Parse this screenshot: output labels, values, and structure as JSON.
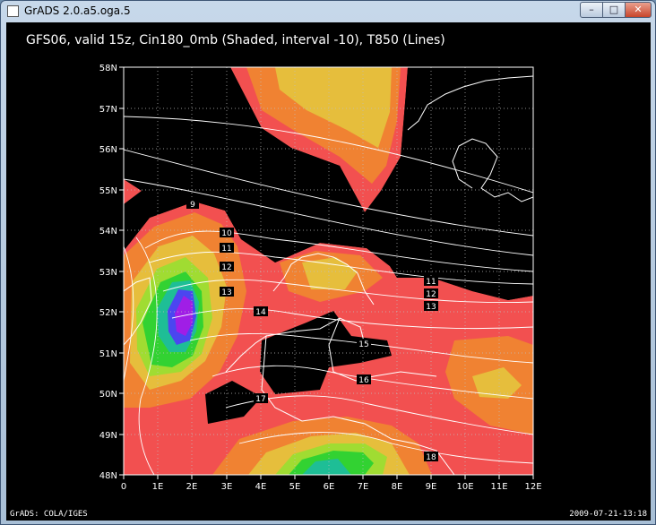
{
  "window": {
    "title": "GrADS 2.0.a5.oga.5",
    "controls": {
      "minimize": "–",
      "maximize": "□",
      "close": "✕"
    }
  },
  "plot": {
    "heading": "GFS06, valid 15z, Cin180_0mb (Shaded, interval -10), T850 (Lines)",
    "y_ticks": [
      "58N",
      "57N",
      "56N",
      "55N",
      "54N",
      "53N",
      "52N",
      "51N",
      "50N",
      "49N",
      "48N"
    ],
    "x_ticks": [
      "0",
      "1E",
      "2E",
      "3E",
      "4E",
      "5E",
      "6E",
      "7E",
      "8E",
      "9E",
      "10E",
      "11E",
      "12E"
    ],
    "contour_labels": [
      "9",
      "10",
      "11",
      "12",
      "13",
      "14",
      "15",
      "16",
      "17",
      "11",
      "12",
      "13",
      "18"
    ],
    "footer_left": "GrADS: COLA/IGES",
    "footer_right": "2009-07-21-13:18"
  },
  "colors": {
    "background": "#000000",
    "shade_red": "#f25050",
    "shade_orange": "#f08232",
    "shade_yellow": "#e6be3c",
    "shade_lime": "#a0dc32",
    "shade_green": "#32d232",
    "shade_teal": "#1ebe96",
    "shade_blue": "#4b46f0",
    "shade_purple": "#a01ee6",
    "contour_line": "#ffffff"
  }
}
